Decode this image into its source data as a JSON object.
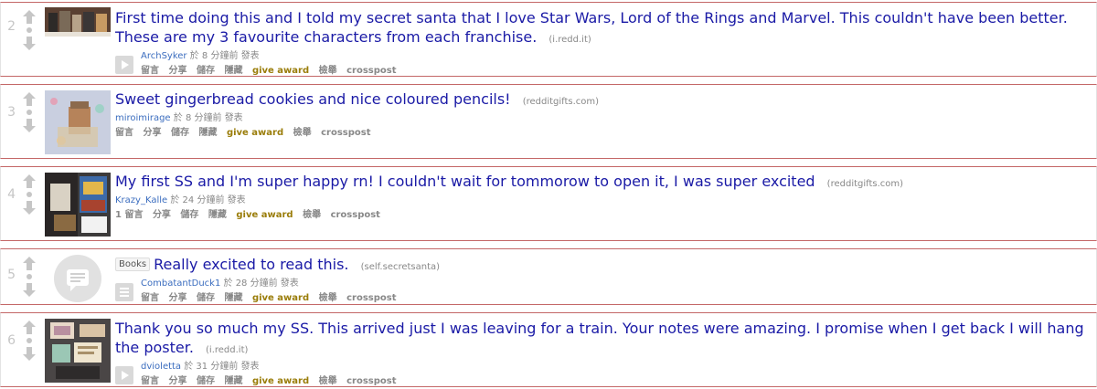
{
  "posts": [
    {
      "rank": "2",
      "title": "First time doing this and I told my secret santa that I love Star Wars, Lord of the Rings and Marvel. This couldn't have been better. These are my 3 favourite characters from each franchise.",
      "domain": "(i.redd.it)",
      "author": "ArchSyker",
      "time_prefix": "於 8 分鐘前 發表",
      "comments": "留言",
      "expando": "play"
    },
    {
      "rank": "3",
      "title": "Sweet gingerbread cookies and nice coloured pencils!",
      "domain": "(redditgifts.com)",
      "author": "miroimirage",
      "time_prefix": "於 8 分鐘前 發表",
      "comments": "留言",
      "expando": ""
    },
    {
      "rank": "4",
      "title": "My first SS and I'm super happy rn! I couldn't wait for tommorow to open it, I was super excited",
      "domain": "(redditgifts.com)",
      "author": "Krazy_Kalle",
      "time_prefix": "於 24 分鐘前 發表",
      "comments": "1 留言",
      "expando": ""
    },
    {
      "rank": "5",
      "flair": "Books",
      "title": "Really excited to read this.",
      "domain": "(self.secretsanta)",
      "author": "CombatantDuck1",
      "time_prefix": "於 28 分鐘前 發表",
      "comments": "留言",
      "expando": "text"
    },
    {
      "rank": "6",
      "title": "Thank you so much my SS. This arrived just I was leaving for a train. Your notes were amazing. I promise when I get back I will hang the poster.",
      "domain": "(i.redd.it)",
      "author": "dvioletta",
      "time_prefix": "於 31 分鐘前 發表",
      "comments": "留言",
      "expando": "play"
    }
  ],
  "actions": {
    "share": "分享",
    "save": "儲存",
    "hide": "隱藏",
    "award": "give award",
    "report": "檢舉",
    "crosspost": "crosspost"
  },
  "colors": {
    "title": "#1a1aa6",
    "author": "#3b6dbf",
    "award": "#9a7d0a",
    "separator": "#c46767"
  }
}
